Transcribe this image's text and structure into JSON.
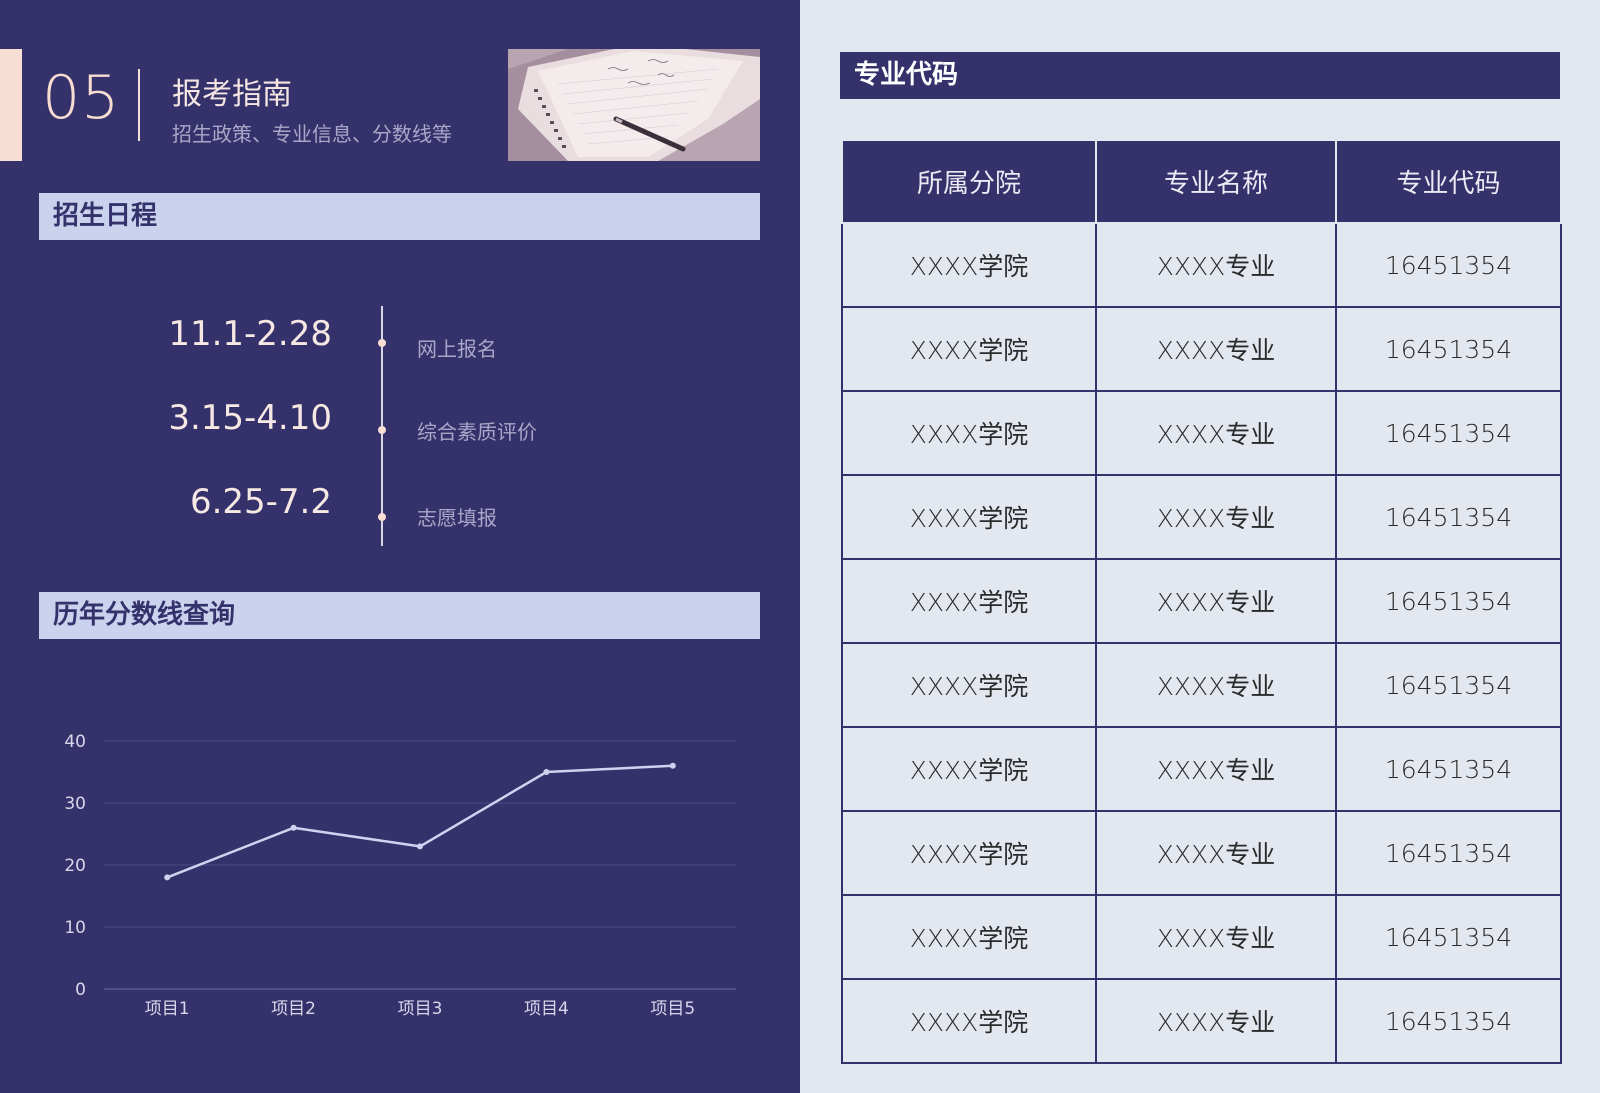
{
  "header": {
    "section_number": "05",
    "title": "报考指南",
    "subtitle": "招生政策、专业信息、分数线等"
  },
  "schedule": {
    "heading": "招生日程",
    "items": [
      {
        "date": "11.1-2.28",
        "event": "网上报名"
      },
      {
        "date": "3.15-4.10",
        "event": "综合素质评价"
      },
      {
        "date": "6.25-7.2",
        "event": "志愿填报"
      }
    ]
  },
  "scores": {
    "heading": "历年分数线查询"
  },
  "chart_data": {
    "type": "line",
    "categories": [
      "项目1",
      "项目2",
      "项目3",
      "项目4",
      "项目5"
    ],
    "series": [
      {
        "values": [
          18,
          26,
          23,
          35,
          36
        ]
      }
    ],
    "yticks": [
      "0",
      "10",
      "20",
      "30",
      "40"
    ],
    "ylim": [
      0,
      40
    ],
    "grid": true,
    "line_color": "#cfd3f0"
  },
  "codes": {
    "heading": "专业代码",
    "columns": [
      "所属分院",
      "专业名称",
      "专业代码"
    ],
    "rows": [
      [
        "XXXX学院",
        "XXXX专业",
        "16451354"
      ],
      [
        "XXXX学院",
        "XXXX专业",
        "16451354"
      ],
      [
        "XXXX学院",
        "XXXX专业",
        "16451354"
      ],
      [
        "XXXX学院",
        "XXXX专业",
        "16451354"
      ],
      [
        "XXXX学院",
        "XXXX专业",
        "16451354"
      ],
      [
        "XXXX学院",
        "XXXX专业",
        "16451354"
      ],
      [
        "XXXX学院",
        "XXXX专业",
        "16451354"
      ],
      [
        "XXXX学院",
        "XXXX专业",
        "16451354"
      ],
      [
        "XXXX学院",
        "XXXX专业",
        "16451354"
      ],
      [
        "XXXX学院",
        "XXXX专业",
        "16451354"
      ]
    ]
  },
  "colors": {
    "primary": "#35316b",
    "accent": "#f7ddd2",
    "band": "#cad2ee",
    "light_bg": "#e3e8f0"
  }
}
